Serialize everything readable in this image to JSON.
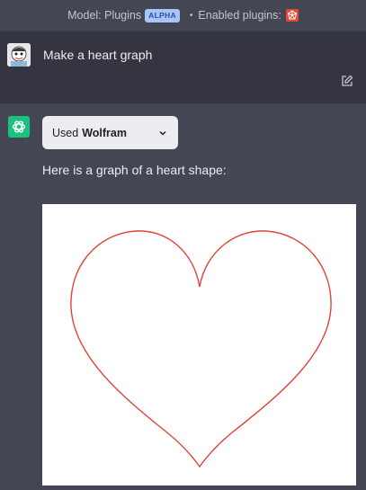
{
  "topbar": {
    "model_label": "Model: Plugins",
    "alpha_badge": "ALPHA",
    "separator": "•",
    "enabled_label": "Enabled plugins:",
    "plugin_icon": "wolfram-icon"
  },
  "user_message": {
    "avatar_icon": "user-avatar",
    "text": "Make a heart graph",
    "edit_icon": "edit-icon"
  },
  "assistant_message": {
    "avatar_icon": "openai-logo",
    "plugin_pill": {
      "prefix": "Used",
      "plugin_name": "Wolfram",
      "chevron_icon": "chevron-down-icon"
    },
    "text": "Here is a graph of a heart shape:",
    "graph": {
      "curve_color": "#e0443a",
      "background": "#ffffff",
      "shape": "heart"
    }
  },
  "colors": {
    "header_bg": "#444654",
    "user_row_bg": "#343541",
    "assistant_row_bg": "#444654",
    "accent_green": "#19c37d",
    "alpha_badge_bg": "#a7c6f7"
  }
}
